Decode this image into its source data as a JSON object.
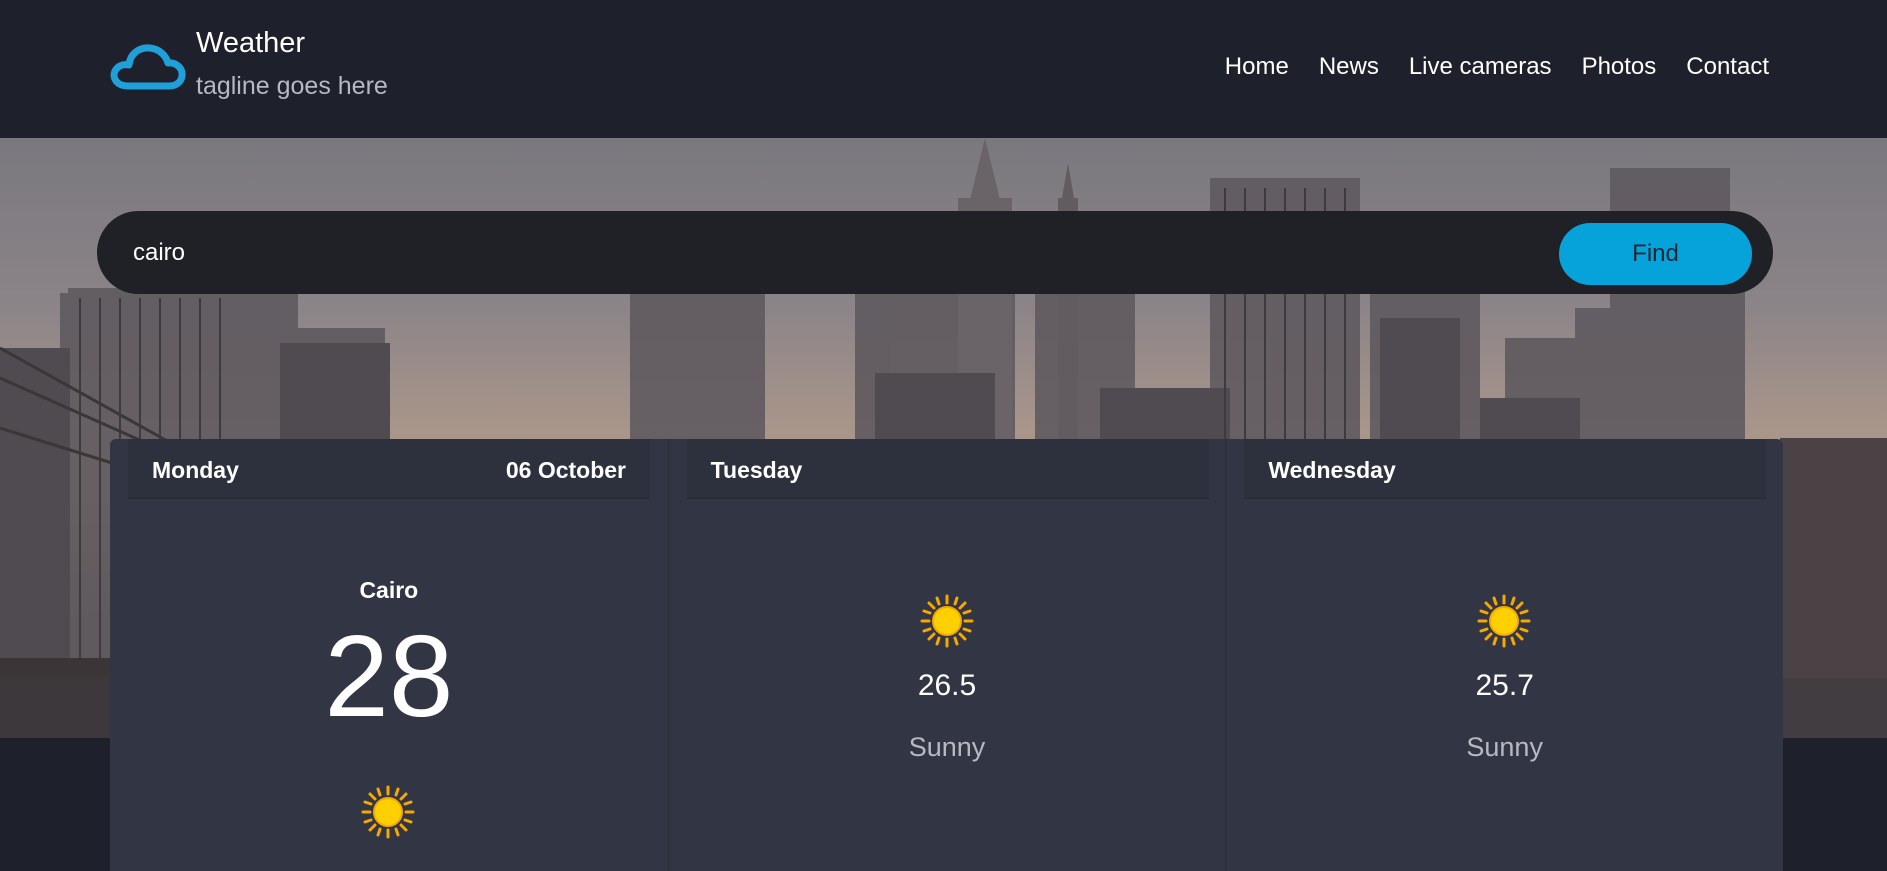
{
  "brand": {
    "title": "Weather",
    "tagline": "tagline goes here",
    "logo_icon": "cloud-icon",
    "accent_color": "#06a3da"
  },
  "nav": {
    "items": [
      {
        "label": "Home"
      },
      {
        "label": "News"
      },
      {
        "label": "Live cameras"
      },
      {
        "label": "Photos"
      },
      {
        "label": "Contact"
      }
    ]
  },
  "search": {
    "value": "cairo",
    "button_label": "Find"
  },
  "forecast": {
    "today": {
      "day": "Monday",
      "date": "06 October",
      "city": "Cairo",
      "temp": "28",
      "icon": "sun-icon"
    },
    "days": [
      {
        "day": "Tuesday",
        "temp": "26.5",
        "condition": "Sunny",
        "icon": "sun-icon"
      },
      {
        "day": "Wednesday",
        "temp": "25.7",
        "condition": "Sunny",
        "icon": "sun-icon"
      }
    ]
  }
}
